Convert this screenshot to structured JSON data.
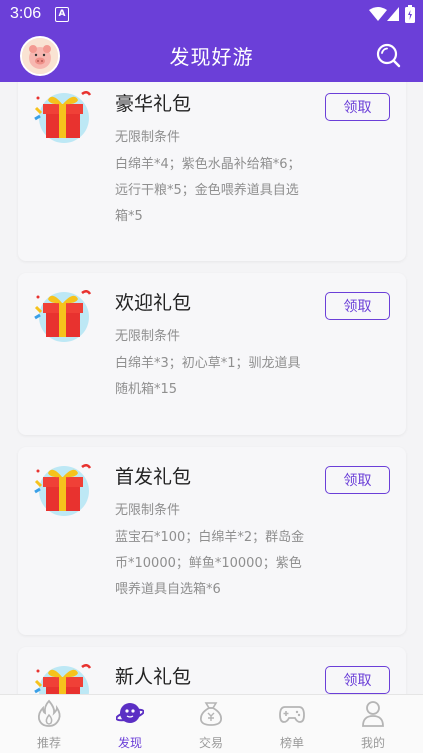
{
  "status_bar": {
    "time": "3:06",
    "a_icon": "A"
  },
  "header": {
    "title": "发现好游"
  },
  "gifts": [
    {
      "name": "豪华礼包",
      "condition": "无限制条件",
      "rewards": "白绵羊*4；紫色水晶补给箱*6；远行干粮*5；金色喂养道具自选箱*5",
      "claim_label": "领取"
    },
    {
      "name": "欢迎礼包",
      "condition": "无限制条件",
      "rewards": "白绵羊*3；初心草*1；驯龙道具随机箱*15",
      "claim_label": "领取"
    },
    {
      "name": "首发礼包",
      "condition": "无限制条件",
      "rewards": "蓝宝石*100；白绵羊*2；群岛金币*10000；鲜鱼*10000；紫色喂养道具自选箱*6",
      "claim_label": "领取"
    },
    {
      "name": "新人礼包",
      "condition": "",
      "rewards": "",
      "claim_label": "领取"
    }
  ],
  "nav": [
    {
      "label": "推荐",
      "icon": "flame-icon"
    },
    {
      "label": "发现",
      "icon": "planet-icon",
      "active": true
    },
    {
      "label": "交易",
      "icon": "money-bag-icon"
    },
    {
      "label": "榜单",
      "icon": "gamepad-icon"
    },
    {
      "label": "我的",
      "icon": "person-icon"
    }
  ],
  "colors": {
    "accent": "#6b3fd8",
    "gift_red": "#e8322f",
    "gift_bg": "#bde8f5",
    "ribbon": "#f6c21c"
  }
}
